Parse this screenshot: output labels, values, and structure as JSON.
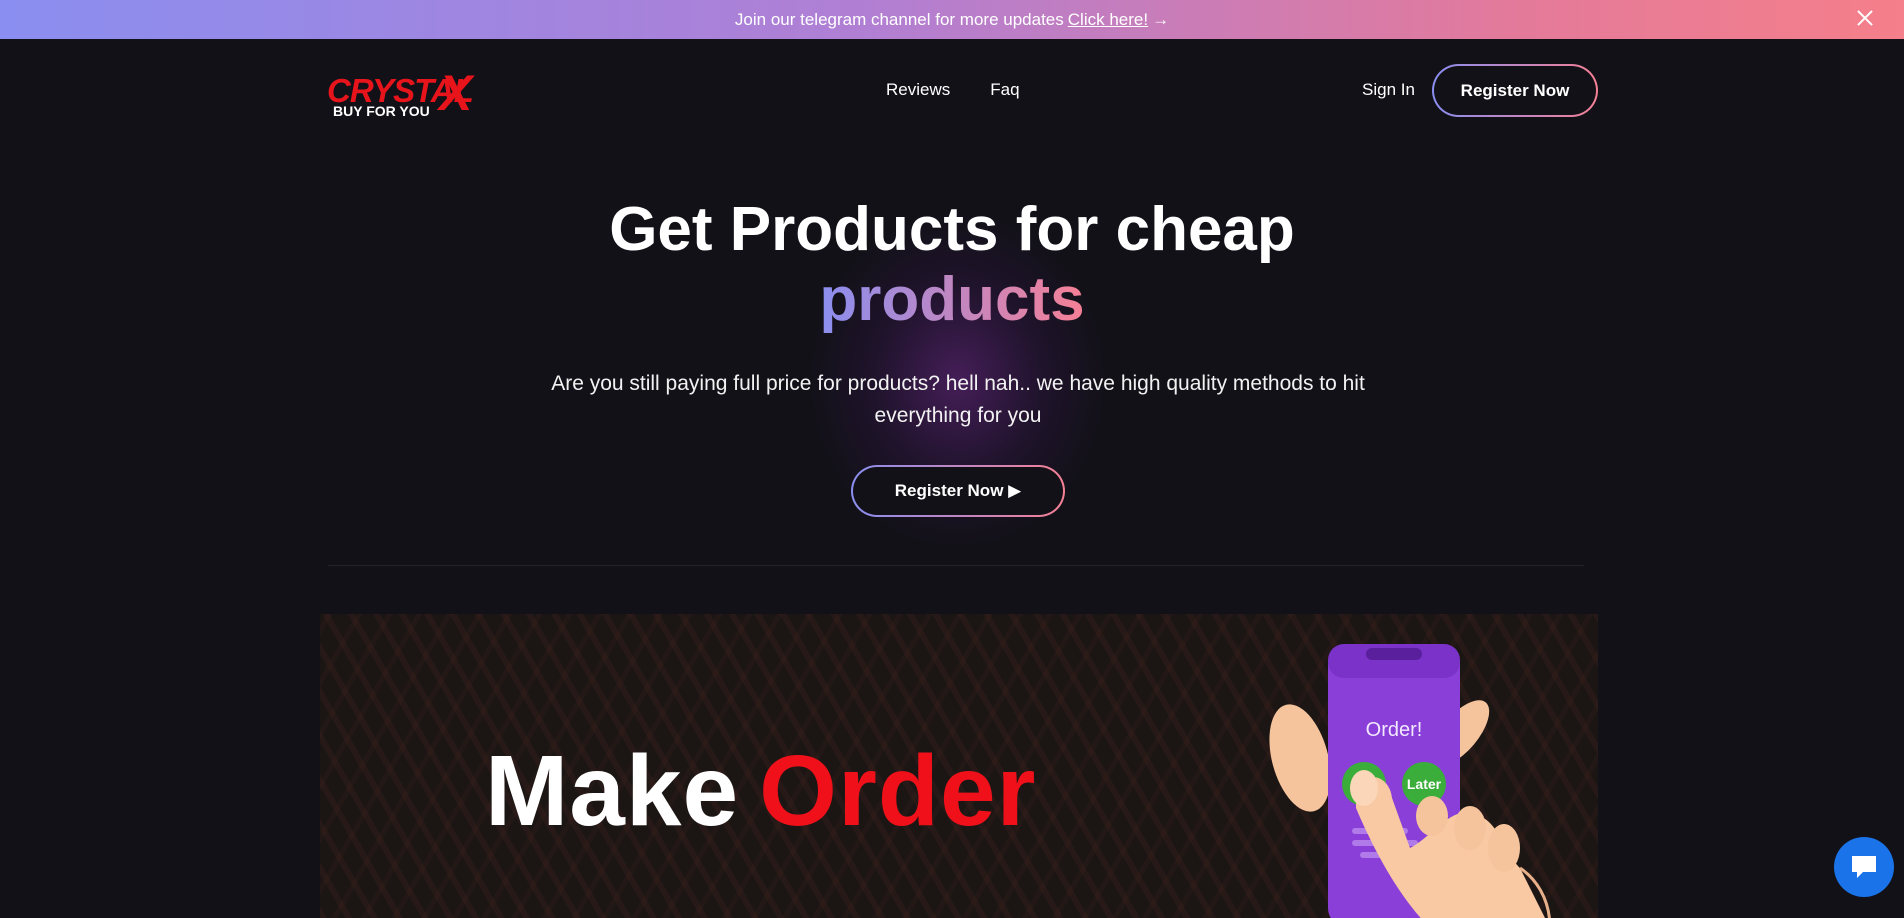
{
  "announcement": {
    "text": "Join our telegram channel for more updates",
    "link_label": "Click here!",
    "arrow": "→"
  },
  "brand": {
    "name": "CRYSTAL",
    "mark": "X",
    "tagline": "BUY FOR YOU"
  },
  "nav": {
    "links": [
      "Reviews",
      "Faq"
    ],
    "signin_label": "Sign In",
    "register_label": "Register Now"
  },
  "hero": {
    "title_line1": "Get Products for cheap",
    "title_line2": "products",
    "subtitle": "Are you still paying full price for products? hell nah.. we have high quality methods to hit everything for you",
    "cta_label": "Register Now ▶"
  },
  "banner": {
    "word1": "Make",
    "word2": "Order",
    "phone_title": "Order!",
    "button_later": "Later"
  },
  "colors": {
    "background": "#121118",
    "accent_start": "#8a8ef0",
    "accent_end": "#f58095",
    "brand_red": "#e8141c",
    "chat_blue": "#1a73e8"
  },
  "icons": {
    "close": "close-icon",
    "chat": "chat-bubble-icon"
  }
}
